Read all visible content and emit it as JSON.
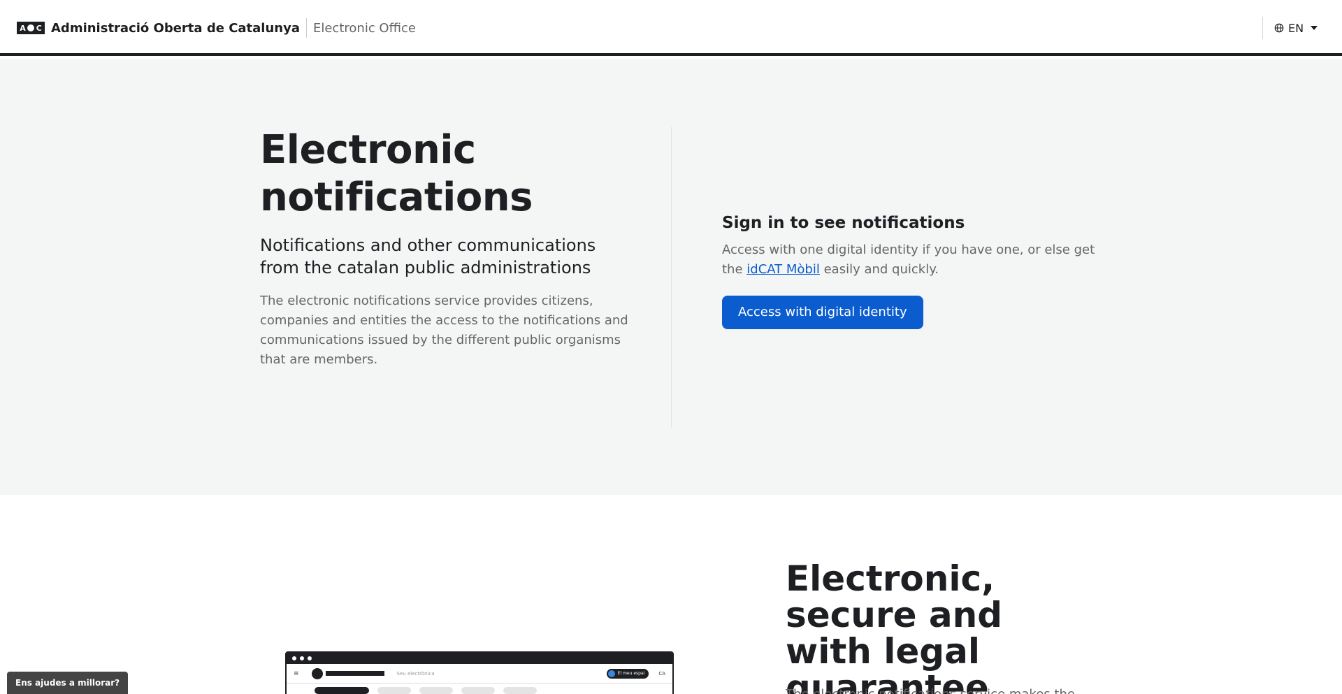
{
  "header": {
    "logo_text": "AOC",
    "organization": "Administració Oberta de Catalunya",
    "office": "Electronic Office",
    "language": "EN"
  },
  "hero": {
    "title": "Electronic notifications",
    "subtitle": "Notifications and other communications from the catalan public administrations",
    "description": "The electronic notifications service provides citizens, companies and entities the access to the notifications and communications issued by the different public organisms that are members."
  },
  "signin": {
    "title": "Sign in to see notifications",
    "text_before": "Access with one digital identity if you have one, or else get the ",
    "link": "idCAT Mòbil",
    "text_after": " easily and quickly.",
    "button": "Access with digital identity"
  },
  "section2": {
    "title": "Electronic, secure and with legal guarantee",
    "text": "The electronic notifications service makes the",
    "mockup": {
      "menu": "≡",
      "subtitle": "Seu electrònica",
      "pill": "El meu espai",
      "pill_initial": "M",
      "lang": "CA"
    }
  },
  "feedback": {
    "label": "Ens ajudes a millorar?"
  },
  "icons": {
    "language": "globe-icon",
    "dropdown": "chevron-down-icon"
  },
  "colors": {
    "primary": "#0a5ccf",
    "dark": "#1d1f22",
    "hero_bg": "#f4f5f5",
    "muted_text": "#666666"
  }
}
